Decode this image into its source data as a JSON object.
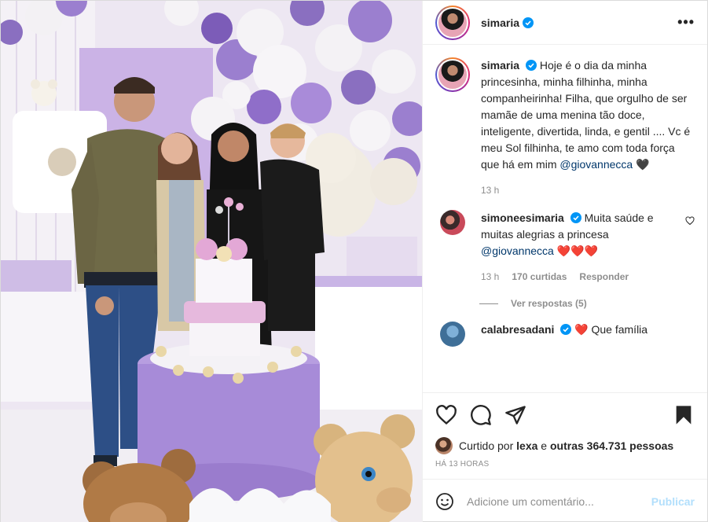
{
  "post": {
    "username": "simaria",
    "more_label": "•••"
  },
  "caption": {
    "username": "simaria",
    "text": "Hoje é o dia da minha princesinha, minha filhinha, minha companheirinha! Filha, que orgulho de ser mamãe de uma menina tão doce, inteligente, divertida, linda, e gentil .... Vc é meu Sol filhinha,  te amo com toda força que há em mim",
    "mention": "@giovannecca",
    "emoji": "🖤",
    "time": "13 h"
  },
  "comment1": {
    "username": "simoneesimaria",
    "text": "Muita saúde e muitas alegrias a princesa",
    "mention": "@giovannecca",
    "emoji": "❤️❤️❤️",
    "time": "13 h",
    "likes": "170 curtidas",
    "reply": "Responder",
    "view_replies": "Ver respostas (5)"
  },
  "comment2": {
    "username": "calabresadani",
    "text": "❤️ Que família"
  },
  "likes": {
    "prefix": "Curtido por",
    "user": "lexa",
    "conj": "e",
    "others": "outras 364.731 pessoas"
  },
  "timestamp": "HÁ 13 HORAS",
  "add_comment": {
    "placeholder": "Adicione um comentário...",
    "publish": "Publicar"
  },
  "colors": {
    "verified": "#0095f6",
    "like_red": "#ed4956",
    "publish_disabled": "#b2dffc",
    "balloon_purple": "#9b7fcf",
    "cake_purple": "#a78bd8"
  }
}
